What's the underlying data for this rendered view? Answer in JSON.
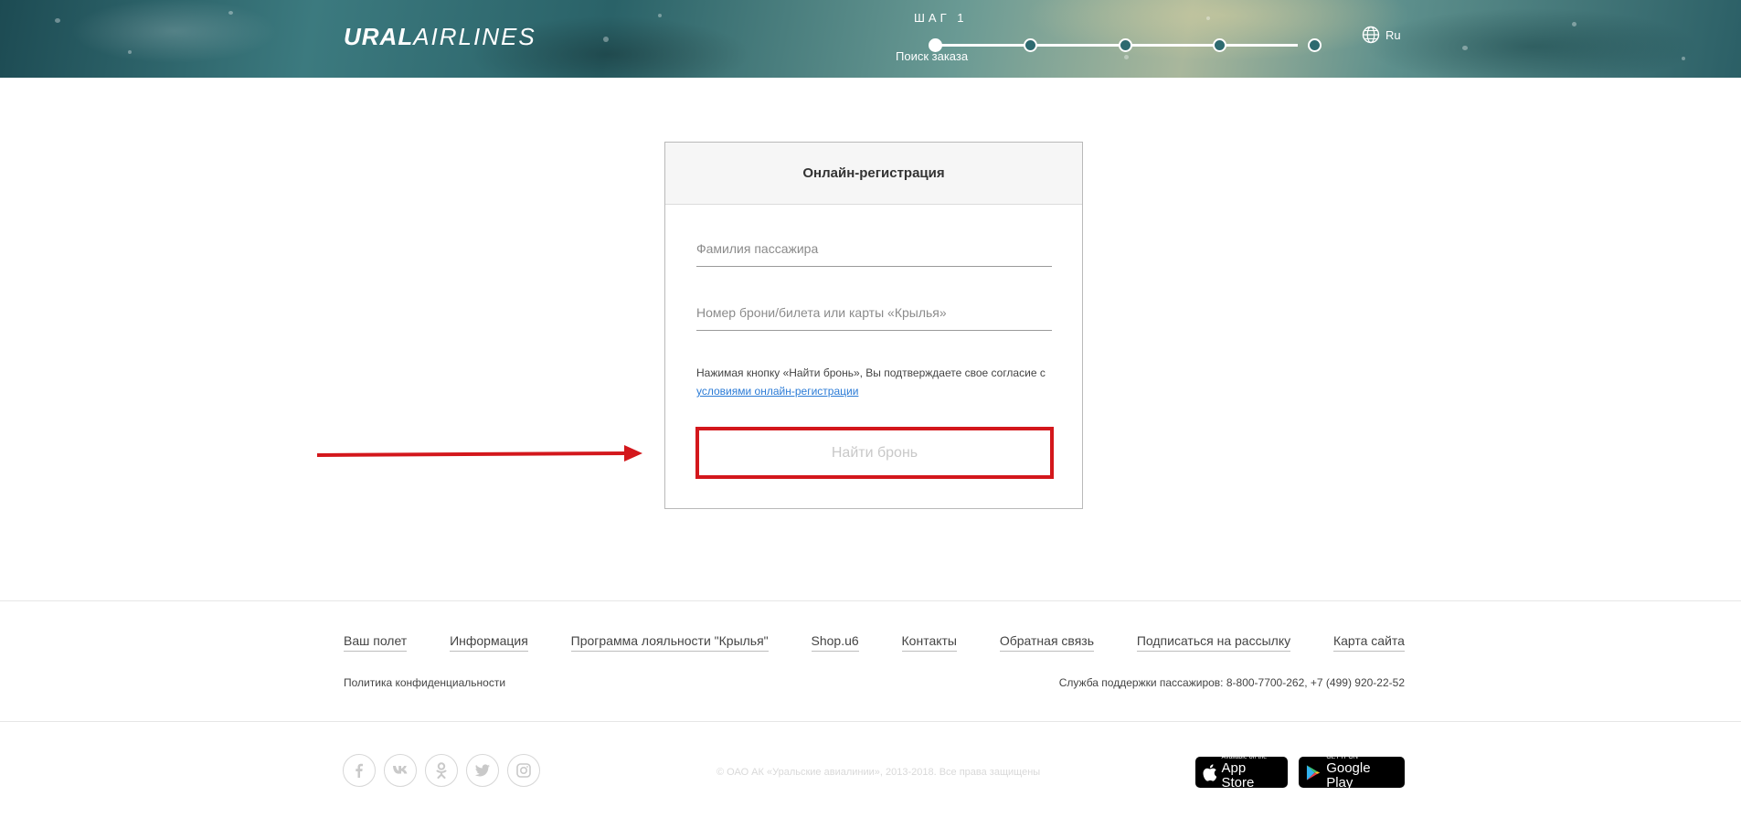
{
  "header": {
    "logo_part1": "URAL",
    "logo_part2": "AIRLINES",
    "step_label": "ШАГ 1",
    "step_caption": "Поиск заказа",
    "language": "Ru"
  },
  "form": {
    "title": "Онлайн-регистрация",
    "surname_placeholder": "Фамилия пассажира",
    "booking_placeholder": "Номер брони/билета или карты «Крылья»",
    "consent_text": "Нажимая кнопку «Найти бронь», Вы подтверждаете свое согласие с",
    "consent_link": "условиями онлайн-регистрации",
    "submit_label": "Найти бронь"
  },
  "footer": {
    "nav": [
      "Ваш полет",
      "Информация",
      "Программа лояльности \"Крылья\"",
      "Shop.u6",
      "Контакты",
      "Обратная связь",
      "Подписаться на рассылку",
      "Карта сайта"
    ],
    "privacy": "Политика конфиденциальности",
    "support": "Служба поддержки пассажиров: 8-800-7700-262, +7 (499) 920-22-52",
    "copyright": "© ОАО АК «Уральские авиалинии», 2013-2018. Все права защищены",
    "socials": [
      "facebook-icon",
      "vk-icon",
      "odnoklassniki-icon",
      "twitter-icon",
      "instagram-icon"
    ],
    "app_store_small": "Available on the",
    "app_store_large": "App Store",
    "google_play_small": "GET IT ON",
    "google_play_large": "Google Play"
  },
  "colors": {
    "highlight_red": "#d3171c",
    "link_blue": "#2b7bd6"
  }
}
